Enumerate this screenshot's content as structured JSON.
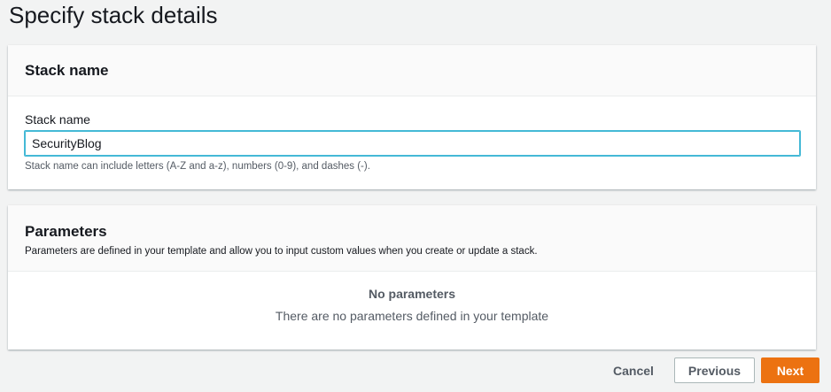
{
  "page_title": "Specify stack details",
  "stack_panel": {
    "header": "Stack name",
    "field_label": "Stack name",
    "value": "SecurityBlog",
    "hint": "Stack name can include letters (A-Z and a-z), numbers (0-9), and dashes (-)."
  },
  "parameters_panel": {
    "header": "Parameters",
    "description": "Parameters are defined in your template and allow you to input custom values when you create or update a stack.",
    "empty_title": "No parameters",
    "empty_text": "There are no parameters defined in your template"
  },
  "actions": {
    "cancel": "Cancel",
    "previous": "Previous",
    "next": "Next"
  },
  "colors": {
    "primary": "#ec7211",
    "focus": "#44b9d6"
  }
}
